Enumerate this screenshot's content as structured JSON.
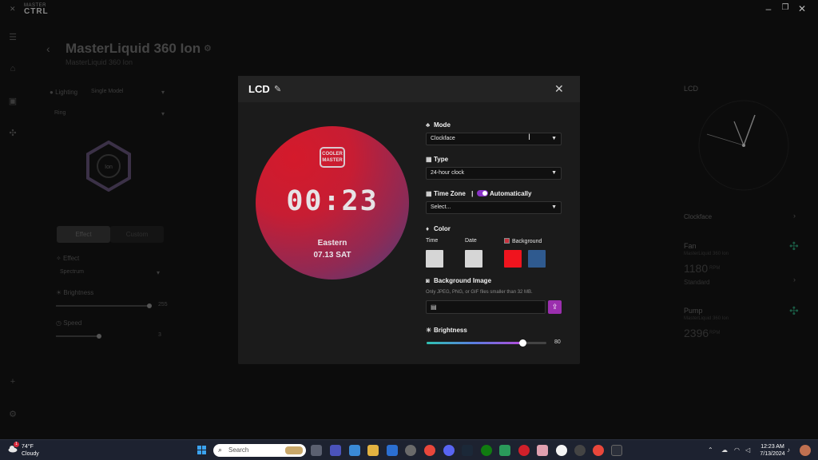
{
  "app": {
    "brand_small": "MASTER",
    "brand_big": "CTRL",
    "device_title": "MasterLiquid 360 Ion",
    "device_subtitle": "MasterLiquid 360 Ion"
  },
  "left_panel": {
    "lighting_label": "Lighting",
    "lighting_mode": "Single Model",
    "zone": "Ring",
    "effect_tab": "Effect",
    "custom_tab": "Custom",
    "effect_label": "Effect",
    "effect_value": "Spectrum",
    "brightness_label": "Brightness",
    "brightness_value": "255",
    "speed_label": "Speed",
    "speed_value": "3",
    "hex_label": "Ion"
  },
  "right_panel": {
    "lcd_label": "LCD",
    "clockface_label": "Clockface",
    "fan_label": "Fan",
    "fan_sub": "MasterLiquid 360 Ion",
    "fan_rpm": "1180",
    "rpm_unit": "RPM",
    "fan_mode": "Standard",
    "pump_label": "Pump",
    "pump_sub": "MasterLiquid 360 Ion",
    "pump_rpm": "2396"
  },
  "modal": {
    "title": "LCD",
    "preview": {
      "logo_line1": "COOLER",
      "logo_line2": "MASTER",
      "time": "00:23",
      "zone": "Eastern",
      "date": "07.13 SAT"
    },
    "mode": {
      "label": "Mode",
      "value": "Clockface"
    },
    "type": {
      "label": "Type",
      "value": "24-hour clock"
    },
    "timezone": {
      "label": "Time Zone",
      "separator": "|",
      "auto_label": "Automatically",
      "auto_on": true,
      "value": "Select..."
    },
    "color": {
      "label": "Color",
      "time_label": "Time",
      "date_label": "Date",
      "background_label": "Background",
      "time_color": "#d6d6d6",
      "date_color": "#d6d6d6",
      "bg_color_1": "#f0141e",
      "bg_color_2": "#2f5a8f"
    },
    "background_image": {
      "label": "Background Image",
      "hint": "Only JPEG, PNG, or GIF files smaller than 32 MB."
    },
    "brightness": {
      "label": "Brightness",
      "value": 80,
      "value_text": "80"
    }
  },
  "taskbar": {
    "weather_temp": "74°F",
    "weather_cond": "Cloudy",
    "weather_badge": "1",
    "search_placeholder": "Search",
    "time": "12:23 AM",
    "date": "7/13/2024"
  }
}
